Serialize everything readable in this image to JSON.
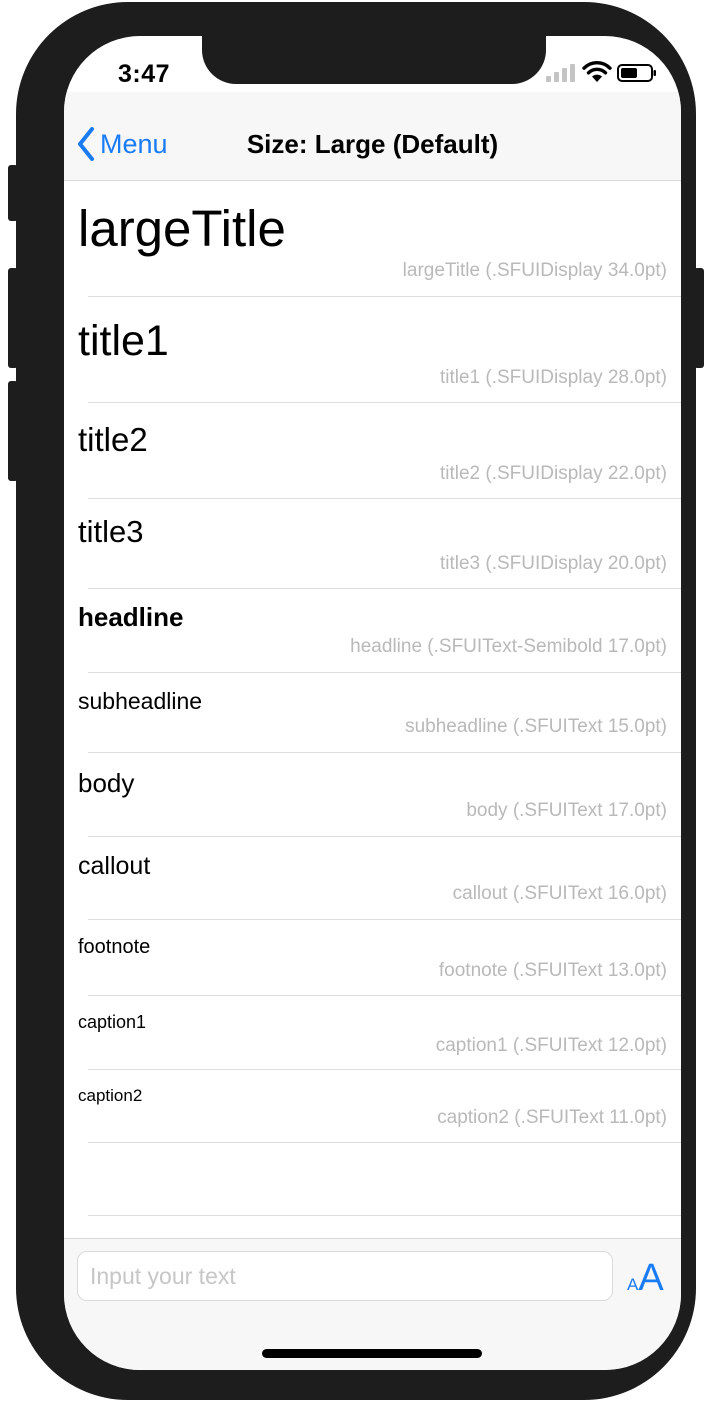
{
  "status_bar": {
    "time": "3:47"
  },
  "nav": {
    "back_label": "Menu",
    "title": "Size: Large (Default)"
  },
  "styles": [
    {
      "name": "largeTitle",
      "detail": "largeTitle (.SFUIDisplay 34.0pt)"
    },
    {
      "name": "title1",
      "detail": "title1 (.SFUIDisplay 28.0pt)"
    },
    {
      "name": "title2",
      "detail": "title2 (.SFUIDisplay 22.0pt)"
    },
    {
      "name": "title3",
      "detail": "title3 (.SFUIDisplay 20.0pt)"
    },
    {
      "name": "headline",
      "detail": "headline (.SFUIText-Semibold 17.0pt)"
    },
    {
      "name": "subheadline",
      "detail": "subheadline (.SFUIText 15.0pt)"
    },
    {
      "name": "body",
      "detail": "body (.SFUIText 17.0pt)"
    },
    {
      "name": "callout",
      "detail": "callout (.SFUIText 16.0pt)"
    },
    {
      "name": "footnote",
      "detail": "footnote (.SFUIText 13.0pt)"
    },
    {
      "name": "caption1",
      "detail": "caption1 (.SFUIText 12.0pt)"
    },
    {
      "name": "caption2",
      "detail": "caption2 (.SFUIText 11.0pt)"
    }
  ],
  "input": {
    "placeholder": "Input your text",
    "value": ""
  },
  "font_size_button": {
    "small": "A",
    "large": "A"
  },
  "colors": {
    "accent": "#1a7cf5",
    "secondary_text": "#b9b9b9"
  }
}
